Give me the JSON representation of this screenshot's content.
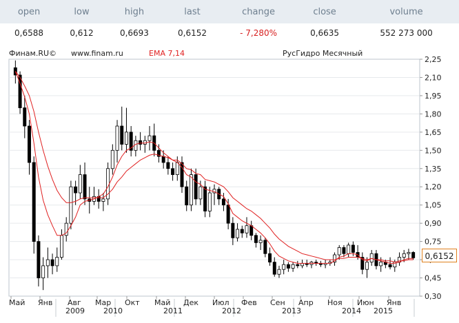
{
  "quote": {
    "headers": [
      "open",
      "low",
      "high",
      "last",
      "change",
      "close",
      "volume"
    ],
    "values": [
      "0,6588",
      "0,612",
      "0,6693",
      "0,6152",
      "- 7,280%",
      "0,6635",
      "552 273 000"
    ]
  },
  "chart_meta": {
    "source": "Финам.RU©",
    "site": "www.finam.ru",
    "indicator": "EMA 7,14",
    "instrument": "РусГидро Месячный",
    "last_price_label": "0,6152"
  },
  "colors": {
    "header_bg": "#e8edf2",
    "header_text": "#6e7f8f",
    "negative": "#d71f1f",
    "ema": "#e02020",
    "badge_border": "#e0801d",
    "candle": "#000000"
  },
  "chart_data": {
    "type": "candlestick",
    "title": "РусГидро Месячный",
    "ylim": [
      0.3,
      2.25
    ],
    "y_ticks": [
      "2,25",
      "2,10",
      "1,95",
      "1,80",
      "1,65",
      "1,50",
      "1,35",
      "1,20",
      "1,05",
      "0,90",
      "0,75",
      "0,60",
      "0,45",
      "0,30"
    ],
    "x_month_labels": [
      "Май",
      "Янв",
      "Авг",
      "Мар",
      "Окт",
      "Май",
      "Дек",
      "Июл",
      "Фев",
      "Сен",
      "Апр",
      "Ноя",
      "Июн",
      "Янв"
    ],
    "x_year_labels": [
      "2009",
      "2010",
      "2011",
      "2012",
      "2013",
      "2014",
      "2015"
    ],
    "start_period": "2008-05",
    "end_period": "2015-02",
    "candles_ohlc": [
      [
        2.18,
        2.24,
        2.05,
        2.12
      ],
      [
        2.12,
        2.15,
        1.8,
        1.85
      ],
      [
        1.85,
        1.95,
        1.6,
        1.7
      ],
      [
        1.7,
        1.75,
        1.3,
        1.4
      ],
      [
        1.4,
        1.45,
        0.65,
        0.75
      ],
      [
        0.75,
        0.8,
        0.38,
        0.45
      ],
      [
        0.45,
        0.62,
        0.35,
        0.55
      ],
      [
        0.55,
        0.7,
        0.45,
        0.6
      ],
      [
        0.6,
        0.65,
        0.48,
        0.55
      ],
      [
        0.55,
        0.7,
        0.5,
        0.62
      ],
      [
        0.62,
        0.85,
        0.6,
        0.8
      ],
      [
        0.8,
        0.95,
        0.75,
        0.9
      ],
      [
        0.9,
        1.25,
        0.85,
        1.2
      ],
      [
        1.2,
        1.25,
        1.05,
        1.15
      ],
      [
        1.15,
        1.38,
        1.1,
        1.3
      ],
      [
        1.3,
        1.4,
        1.05,
        1.1
      ],
      [
        1.1,
        1.2,
        0.98,
        1.08
      ],
      [
        1.08,
        1.2,
        1.05,
        1.12
      ],
      [
        1.12,
        1.18,
        1.02,
        1.08
      ],
      [
        1.08,
        1.15,
        1.0,
        1.1
      ],
      [
        1.1,
        1.4,
        1.05,
        1.35
      ],
      [
        1.35,
        1.55,
        1.3,
        1.5
      ],
      [
        1.5,
        1.75,
        1.4,
        1.7
      ],
      [
        1.7,
        1.86,
        1.5,
        1.55
      ],
      [
        1.55,
        1.85,
        1.48,
        1.65
      ],
      [
        1.65,
        1.7,
        1.45,
        1.5
      ],
      [
        1.5,
        1.62,
        1.45,
        1.58
      ],
      [
        1.58,
        1.65,
        1.5,
        1.55
      ],
      [
        1.55,
        1.62,
        1.48,
        1.58
      ],
      [
        1.58,
        1.7,
        1.5,
        1.62
      ],
      [
        1.62,
        1.72,
        1.45,
        1.5
      ],
      [
        1.5,
        1.55,
        1.4,
        1.45
      ],
      [
        1.45,
        1.5,
        1.35,
        1.4
      ],
      [
        1.4,
        1.45,
        1.3,
        1.35
      ],
      [
        1.35,
        1.4,
        1.25,
        1.3
      ],
      [
        1.3,
        1.45,
        1.25,
        1.4
      ],
      [
        1.4,
        1.45,
        1.15,
        1.2
      ],
      [
        1.2,
        1.25,
        1.0,
        1.05
      ],
      [
        1.05,
        1.35,
        1.0,
        1.3
      ],
      [
        1.3,
        1.35,
        1.05,
        1.1
      ],
      [
        1.1,
        1.25,
        1.05,
        1.2
      ],
      [
        1.2,
        1.25,
        0.95,
        1.0
      ],
      [
        1.0,
        1.2,
        0.95,
        1.15
      ],
      [
        1.15,
        1.22,
        1.05,
        1.18
      ],
      [
        1.18,
        1.2,
        1.05,
        1.1
      ],
      [
        1.1,
        1.15,
        1.0,
        1.05
      ],
      [
        1.05,
        1.1,
        0.85,
        0.9
      ],
      [
        0.9,
        0.95,
        0.72,
        0.78
      ],
      [
        0.78,
        0.9,
        0.75,
        0.85
      ],
      [
        0.85,
        0.88,
        0.78,
        0.82
      ],
      [
        0.82,
        0.95,
        0.78,
        0.88
      ],
      [
        0.88,
        0.92,
        0.76,
        0.8
      ],
      [
        0.8,
        0.82,
        0.7,
        0.74
      ],
      [
        0.74,
        0.8,
        0.68,
        0.76
      ],
      [
        0.76,
        0.78,
        0.62,
        0.65
      ],
      [
        0.65,
        0.7,
        0.55,
        0.58
      ],
      [
        0.58,
        0.62,
        0.46,
        0.48
      ],
      [
        0.48,
        0.55,
        0.45,
        0.52
      ],
      [
        0.52,
        0.6,
        0.48,
        0.56
      ],
      [
        0.56,
        0.58,
        0.5,
        0.53
      ],
      [
        0.53,
        0.58,
        0.5,
        0.56
      ],
      [
        0.56,
        0.59,
        0.53,
        0.55
      ],
      [
        0.55,
        0.6,
        0.53,
        0.57
      ],
      [
        0.57,
        0.6,
        0.54,
        0.56
      ],
      [
        0.56,
        0.59,
        0.53,
        0.58
      ],
      [
        0.58,
        0.6,
        0.55,
        0.57
      ],
      [
        0.57,
        0.59,
        0.54,
        0.56
      ],
      [
        0.56,
        0.6,
        0.53,
        0.57
      ],
      [
        0.57,
        0.6,
        0.55,
        0.58
      ],
      [
        0.58,
        0.66,
        0.55,
        0.64
      ],
      [
        0.64,
        0.72,
        0.6,
        0.7
      ],
      [
        0.7,
        0.72,
        0.62,
        0.65
      ],
      [
        0.65,
        0.74,
        0.62,
        0.72
      ],
      [
        0.72,
        0.75,
        0.63,
        0.66
      ],
      [
        0.66,
        0.72,
        0.6,
        0.62
      ],
      [
        0.62,
        0.66,
        0.48,
        0.52
      ],
      [
        0.52,
        0.62,
        0.45,
        0.58
      ],
      [
        0.58,
        0.68,
        0.55,
        0.65
      ],
      [
        0.65,
        0.68,
        0.52,
        0.55
      ],
      [
        0.55,
        0.62,
        0.5,
        0.58
      ],
      [
        0.58,
        0.6,
        0.53,
        0.56
      ],
      [
        0.56,
        0.62,
        0.52,
        0.54
      ],
      [
        0.54,
        0.6,
        0.5,
        0.58
      ],
      [
        0.58,
        0.66,
        0.55,
        0.62
      ],
      [
        0.62,
        0.68,
        0.58,
        0.65
      ],
      [
        0.65,
        0.69,
        0.6,
        0.66
      ],
      [
        0.66,
        0.67,
        0.6,
        0.6152
      ]
    ],
    "ema_fast": [
      2.15,
      2.05,
      1.94,
      1.8,
      1.56,
      1.28,
      1.09,
      0.97,
      0.88,
      0.8,
      0.8,
      0.82,
      0.88,
      0.95,
      1.05,
      1.08,
      1.09,
      1.1,
      1.12,
      1.14,
      1.2,
      1.28,
      1.38,
      1.45,
      1.5,
      1.52,
      1.55,
      1.56,
      1.56,
      1.57,
      1.56,
      1.52,
      1.48,
      1.45,
      1.42,
      1.4,
      1.36,
      1.3,
      1.28,
      1.24,
      1.22,
      1.18,
      1.17,
      1.16,
      1.14,
      1.12,
      1.06,
      0.98,
      0.95,
      0.92,
      0.9,
      0.88,
      0.85,
      0.82,
      0.78,
      0.73,
      0.67,
      0.63,
      0.61,
      0.59,
      0.58,
      0.57,
      0.57,
      0.57,
      0.57,
      0.57,
      0.57,
      0.57,
      0.57,
      0.59,
      0.62,
      0.63,
      0.65,
      0.65,
      0.64,
      0.6,
      0.59,
      0.61,
      0.6,
      0.59,
      0.58,
      0.57,
      0.57,
      0.58,
      0.6,
      0.61,
      0.61
    ],
    "ema_slow": [
      2.15,
      2.1,
      2.03,
      1.95,
      1.82,
      1.65,
      1.5,
      1.37,
      1.26,
      1.17,
      1.11,
      1.07,
      1.07,
      1.08,
      1.1,
      1.11,
      1.11,
      1.11,
      1.11,
      1.11,
      1.14,
      1.18,
      1.24,
      1.28,
      1.33,
      1.36,
      1.39,
      1.42,
      1.44,
      1.46,
      1.47,
      1.46,
      1.45,
      1.44,
      1.42,
      1.42,
      1.39,
      1.35,
      1.34,
      1.31,
      1.3,
      1.26,
      1.25,
      1.24,
      1.22,
      1.2,
      1.16,
      1.11,
      1.08,
      1.05,
      1.02,
      1.0,
      0.97,
      0.94,
      0.9,
      0.86,
      0.81,
      0.77,
      0.74,
      0.71,
      0.69,
      0.67,
      0.65,
      0.64,
      0.63,
      0.62,
      0.61,
      0.6,
      0.6,
      0.6,
      0.61,
      0.61,
      0.62,
      0.62,
      0.62,
      0.61,
      0.6,
      0.61,
      0.6,
      0.6,
      0.59,
      0.59,
      0.58,
      0.59,
      0.59,
      0.6,
      0.6
    ]
  }
}
